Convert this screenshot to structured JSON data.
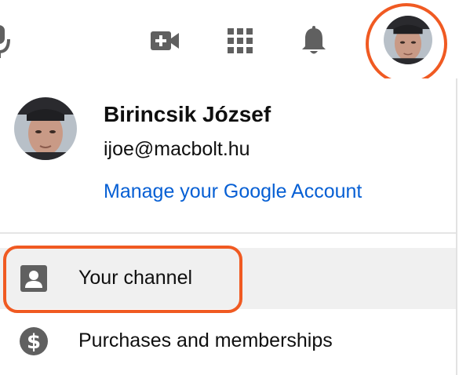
{
  "topbar": {
    "icons": [
      "mic-icon",
      "video-camera-plus-icon",
      "apps-grid-icon",
      "bell-icon"
    ]
  },
  "account": {
    "name": "Birincsik József",
    "email": "ijoe@macbolt.hu",
    "manage_link": "Manage your Google Account"
  },
  "menu": {
    "items": [
      {
        "label": "Your channel",
        "icon": "person-icon",
        "highlighted": true
      },
      {
        "label": "Purchases and memberships",
        "icon": "dollar-icon",
        "highlighted": false
      }
    ]
  },
  "colors": {
    "highlight": "#f05a22",
    "link": "#065fd4",
    "icon": "#606060",
    "active_item_bg": "#f0f0f0"
  }
}
